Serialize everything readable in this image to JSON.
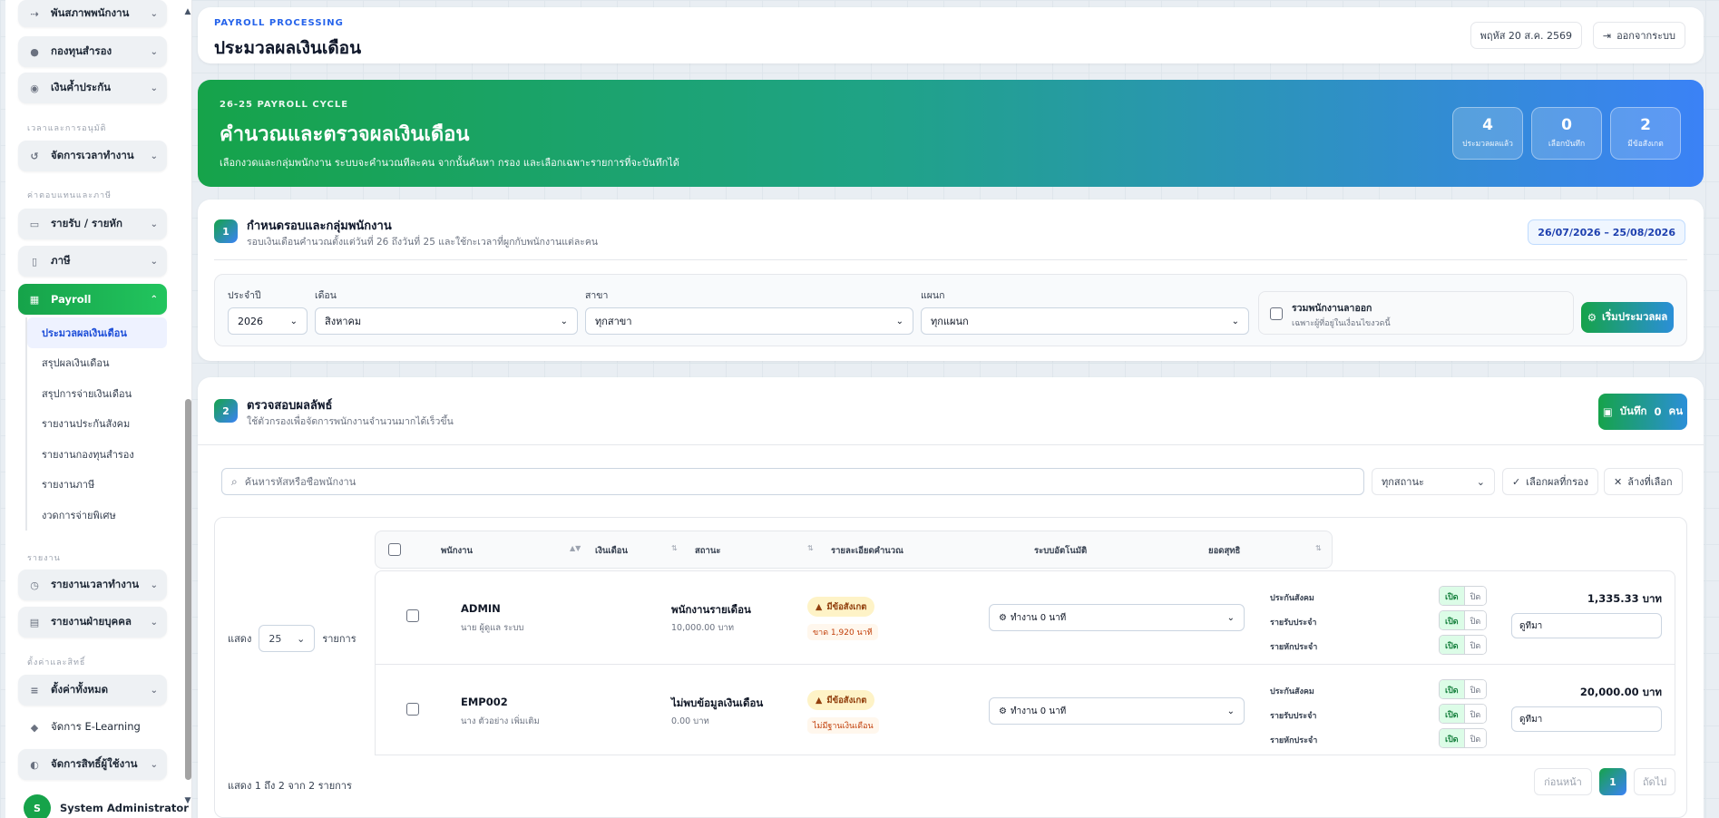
{
  "sidebar": {
    "items_top": [
      {
        "label": "พันสภาพพนักงาน",
        "icon": "running-person-icon"
      },
      {
        "label": "กองทุนสำรอง",
        "icon": "piggy-bank-icon"
      },
      {
        "label": "เงินค้ำประกัน",
        "icon": "hand-coin-icon"
      }
    ],
    "section_time": "เวลาและการอนุมัติ",
    "time_item": "จัดการเวลาทำงาน",
    "section_payroll": "ค่าตอบแทนและภาษี",
    "income_item": "รายรับ / รายหัก",
    "tax_item": "ภาษี",
    "payroll_item": "Payroll",
    "payroll_sub": [
      "ประมวลผลเงินเดือน",
      "สรุปผลเงินเดือน",
      "สรุปการจ่ายเงินเดือน",
      "รายงานประกันสังคม",
      "รายงานกองทุนสำรอง",
      "รายงานภาษี",
      "งวดการจ่ายพิเศษ"
    ],
    "section_reports": "รายงาน",
    "report_time": "รายงานเวลาทำงาน",
    "report_hr": "รายงานฝ่ายบุคคล",
    "section_settings": "ตั้งค่าและสิทธิ์",
    "settings_all": "ตั้งค่าทั้งหมด",
    "elearning": "จัดการ E-Learning",
    "user_rights": "จัดการสิทธิ์ผู้ใช้งาน",
    "user_initial": "S",
    "user_name": "System Administrator"
  },
  "header": {
    "eyebrow": "PAYROLL PROCESSING",
    "title": "ประมวลผลเงินเดือน",
    "date": "พฤหัส 20 ส.ค. 2569",
    "logout": "ออกจากระบบ"
  },
  "hero": {
    "eyebrow": "26-25 PAYROLL CYCLE",
    "title": "คำนวณและตรวจผลเงินเดือน",
    "subtitle": "เลือกงวดและกลุ่มพนักงาน ระบบจะคำนวณทีละคน จากนั้นค้นหา กรอง และเลือกเฉพาะรายการที่จะบันทึกได้",
    "stats": [
      {
        "value": "4",
        "label": "ประมวลผลแล้ว"
      },
      {
        "value": "0",
        "label": "เลือกบันทึก"
      },
      {
        "value": "2",
        "label": "มีข้อสังเกต"
      }
    ]
  },
  "step1": {
    "badge": "1",
    "title": "กำหนดรอบและกลุ่มพนักงาน",
    "desc": "รอบเงินเดือนคำนวณตั้งแต่วันที่ 26 ถึงวันที่ 25 และใช้กะเวลาที่ผูกกับพนักงานแต่ละคน",
    "date_range": "26/07/2026 – 25/08/2026",
    "year_label": "ประจำปี",
    "year_value": "2026",
    "month_label": "เดือน",
    "month_value": "สิงหาคม",
    "branch_label": "สาขา",
    "branch_value": "ทุกสาขา",
    "dept_label": "แผนก",
    "dept_value": "ทุกแผนก",
    "include_resigned": "รวมพนักงานลาออก",
    "include_resigned_sub": "เฉพาะผู้ที่อยู่ในเงื่อนไขงวดนี้",
    "process_btn": "เริ่มประมวลผล"
  },
  "step2": {
    "badge": "2",
    "title": "ตรวจสอบผลลัพธ์",
    "desc": "ใช้ตัวกรองเพื่อจัดการพนักงานจำนวนมากได้เร็วขึ้น",
    "save_label": "บันทึก",
    "save_count": "0",
    "save_unit": "คน",
    "search_placeholder": "ค้นหารหัสหรือชื่อพนักงาน",
    "status_filter": "ทุกสถานะ",
    "select_filtered": "เลือกผลที่กรอง",
    "clear_selection": "ล้างที่เลือก",
    "show_label": "แสดง",
    "page_size": "25",
    "show_unit": "รายการ",
    "columns": [
      "พนักงาน",
      "เงินเดือน",
      "สถานะ",
      "รายละเอียดคำนวณ",
      "ระบบอัตโนมัติ",
      "ยอดสุทธิ"
    ],
    "toggle_on": "เปิด",
    "toggle_off": "ปิด",
    "toggle_labels": [
      "ประกันสังคม",
      "รายรับประจำ",
      "รายหักประจำ"
    ],
    "rows": [
      {
        "code": "ADMIN",
        "name": "นาย ผู้ดูแล ระบบ",
        "salary_type": "พนักงานรายเดือน",
        "salary_amount": "10,000.00 บาท",
        "status": "มีข้อสังเกต",
        "status_detail": "ขาด 1,920 นาที",
        "ot": "ทำงาน 0 นาที",
        "net": "1,335.33 บาท",
        "note": "ดูที่มา"
      },
      {
        "code": "EMP002",
        "name": "นาง ตัวอย่าง เพิ่มเติม",
        "salary_type": "ไม่พบข้อมูลเงินเดือน",
        "salary_amount": "0.00 บาท",
        "status": "มีข้อสังเกต",
        "status_detail": "ไม่มีฐานเงินเดือน",
        "ot": "ทำงาน 0 นาที",
        "net": "20,000.00 บาท",
        "note": "ดูที่มา"
      }
    ],
    "footer_info": "แสดง 1 ถึง 2 จาก 2 รายการ",
    "prev": "ก่อนหน้า",
    "page": "1",
    "next": "ถัดไป"
  },
  "colors": {
    "accent_green": "#16a34a",
    "accent_blue": "#3b82f6",
    "warning": "#fef3c7"
  }
}
